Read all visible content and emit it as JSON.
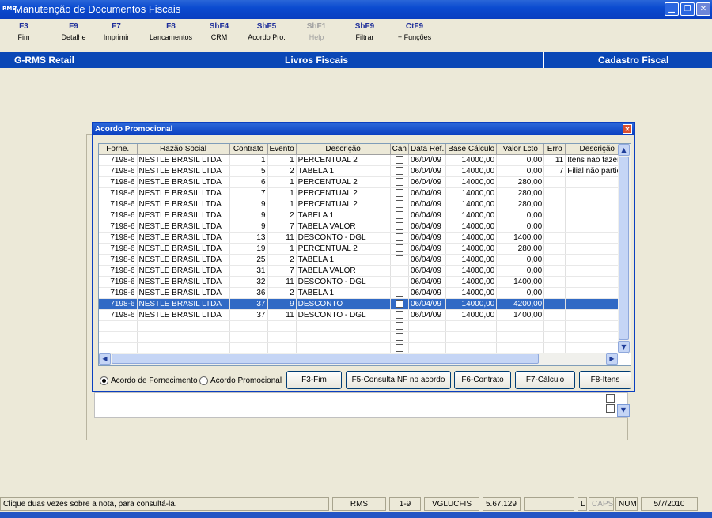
{
  "window": {
    "title": "Manutenção de Documentos Fiscais",
    "app_icon_text": "RMS"
  },
  "fkeys": [
    {
      "key": "F3",
      "label": "Fim",
      "enabled": true
    },
    {
      "key": "F9",
      "label": "Detalhe",
      "enabled": true
    },
    {
      "key": "F7",
      "label": "Imprimir",
      "enabled": true
    },
    {
      "key": "F8",
      "label": "Lancamentos",
      "enabled": true
    },
    {
      "key": "ShF4",
      "label": "CRM",
      "enabled": true
    },
    {
      "key": "ShF5",
      "label": "Acordo Pro.",
      "enabled": true
    },
    {
      "key": "ShF1",
      "label": "Help",
      "enabled": false
    },
    {
      "key": "ShF9",
      "label": "Filtrar",
      "enabled": true
    },
    {
      "key": "CtF9",
      "label": "+ Funções",
      "enabled": true
    }
  ],
  "header": {
    "left": "G-RMS Retail",
    "center": "Livros Fiscais",
    "right": "Cadastro Fiscal"
  },
  "dialog": {
    "title": "Acordo Promocional",
    "columns": [
      "Forne.",
      "Razão Social",
      "Contrato",
      "Evento",
      "Descrição",
      "Can",
      "Data Ref.",
      "Base Cálculo",
      "Valor Lcto",
      "Erro",
      "Descrição"
    ],
    "rows": [
      [
        "7198-6",
        "NESTLE BRASIL LTDA",
        "1",
        "1",
        "PERCENTUAL 2",
        "",
        "06/04/09",
        "14000,00",
        "0,00",
        "11",
        "Itens nao fazem"
      ],
      [
        "7198-6",
        "NESTLE BRASIL LTDA",
        "5",
        "2",
        "TABELA 1",
        "",
        "06/04/09",
        "14000,00",
        "0,00",
        "7",
        "Filial não particip"
      ],
      [
        "7198-6",
        "NESTLE BRASIL LTDA",
        "6",
        "1",
        "PERCENTUAL 2",
        "",
        "06/04/09",
        "14000,00",
        "280,00",
        "",
        ""
      ],
      [
        "7198-6",
        "NESTLE BRASIL LTDA",
        "7",
        "1",
        "PERCENTUAL 2",
        "",
        "06/04/09",
        "14000,00",
        "280,00",
        "",
        ""
      ],
      [
        "7198-6",
        "NESTLE BRASIL LTDA",
        "9",
        "1",
        "PERCENTUAL 2",
        "",
        "06/04/09",
        "14000,00",
        "280,00",
        "",
        ""
      ],
      [
        "7198-6",
        "NESTLE BRASIL LTDA",
        "9",
        "2",
        "TABELA 1",
        "",
        "06/04/09",
        "14000,00",
        "0,00",
        "",
        ""
      ],
      [
        "7198-6",
        "NESTLE BRASIL LTDA",
        "9",
        "7",
        "TABELA VALOR",
        "",
        "06/04/09",
        "14000,00",
        "0,00",
        "",
        ""
      ],
      [
        "7198-6",
        "NESTLE BRASIL LTDA",
        "13",
        "11",
        "DESCONTO - DGL",
        "",
        "06/04/09",
        "14000,00",
        "1400,00",
        "",
        ""
      ],
      [
        "7198-6",
        "NESTLE BRASIL LTDA",
        "19",
        "1",
        "PERCENTUAL 2",
        "",
        "06/04/09",
        "14000,00",
        "280,00",
        "",
        ""
      ],
      [
        "7198-6",
        "NESTLE BRASIL LTDA",
        "25",
        "2",
        "TABELA 1",
        "",
        "06/04/09",
        "14000,00",
        "0,00",
        "",
        ""
      ],
      [
        "7198-6",
        "NESTLE BRASIL LTDA",
        "31",
        "7",
        "TABELA VALOR",
        "",
        "06/04/09",
        "14000,00",
        "0,00",
        "",
        ""
      ],
      [
        "7198-6",
        "NESTLE BRASIL LTDA",
        "32",
        "11",
        "DESCONTO - DGL",
        "",
        "06/04/09",
        "14000,00",
        "1400,00",
        "",
        ""
      ],
      [
        "7198-6",
        "NESTLE BRASIL LTDA",
        "36",
        "2",
        "TABELA 1",
        "",
        "06/04/09",
        "14000,00",
        "0,00",
        "",
        ""
      ],
      [
        "7198-6",
        "NESTLE BRASIL LTDA",
        "37",
        "9",
        "DESCONTO",
        "",
        "06/04/09",
        "14000,00",
        "4200,00",
        "",
        ""
      ],
      [
        "7198-6",
        "NESTLE BRASIL LTDA",
        "37",
        "11",
        "DESCONTO - DGL",
        "",
        "06/04/09",
        "14000,00",
        "1400,00",
        "",
        ""
      ]
    ],
    "selected_row": 13,
    "empty_rows": 3,
    "radios": [
      {
        "label": "Acordo de Fornecimento",
        "checked": true
      },
      {
        "label": "Acordo Promocional",
        "checked": false
      }
    ],
    "buttons": [
      "F3-Fim",
      "F5-Consulta NF no acordo",
      "F6-Contrato",
      "F7-Cálculo",
      "F8-Itens"
    ]
  },
  "statusbar": {
    "message": "Clique duas vezes sobre a nota, para consultá-la.",
    "panels": [
      "RMS",
      "1-9",
      "VGLUCFIS",
      "5.67.129",
      "",
      "L",
      "CAPS",
      "NUM",
      "5/7/2010"
    ]
  },
  "colors": {
    "title_blue": "#0a47b6",
    "selection": "#316ac5",
    "fkey_text": "#1f2f9a"
  }
}
